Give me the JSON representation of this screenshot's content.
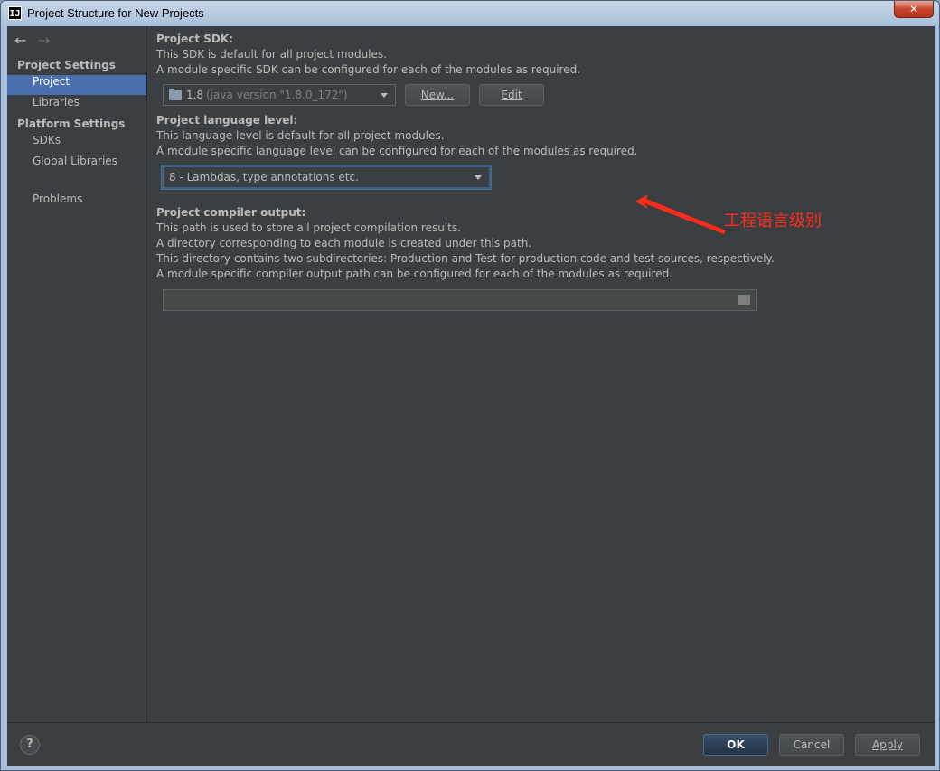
{
  "window": {
    "title": "Project Structure for New Projects",
    "close_label": "✕"
  },
  "nav": {
    "back": "←",
    "forward": "→"
  },
  "sidebar": {
    "section_project_settings": "Project Settings",
    "items_project": [
      {
        "label": "Project"
      },
      {
        "label": "Libraries"
      }
    ],
    "section_platform_settings": "Platform Settings",
    "items_platform": [
      {
        "label": "SDKs"
      },
      {
        "label": "Global Libraries"
      }
    ],
    "problems": "Problems"
  },
  "sdk": {
    "title": "Project SDK:",
    "desc1": "This SDK is default for all project modules.",
    "desc2": "A module specific SDK can be configured for each of the modules as required.",
    "selected_version": "1.8",
    "selected_detail": "(java version \"1.8.0_172\")",
    "new_button": "New...",
    "edit_button": "Edit"
  },
  "language": {
    "title": "Project language level:",
    "desc1": "This language level is default for all project modules.",
    "desc2": "A module specific language level can be configured for each of the modules as required.",
    "selected": "8 - Lambdas, type annotations etc."
  },
  "compiler": {
    "title": "Project compiler output:",
    "desc1": "This path is used to store all project compilation results.",
    "desc2": "A directory corresponding to each module is created under this path.",
    "desc3": "This directory contains two subdirectories: Production and Test for production code and test sources, respectively.",
    "desc4": "A module specific compiler output path can be configured for each of the modules as required.",
    "path_value": ""
  },
  "annotation": {
    "text": "工程语言级别",
    "color": "#ff2b1a"
  },
  "footer": {
    "help": "?",
    "ok": "OK",
    "cancel": "Cancel",
    "apply": "Apply"
  },
  "colors": {
    "background": "#3c3f41",
    "selection": "#4b6eaf",
    "text": "#bbbbbb"
  }
}
